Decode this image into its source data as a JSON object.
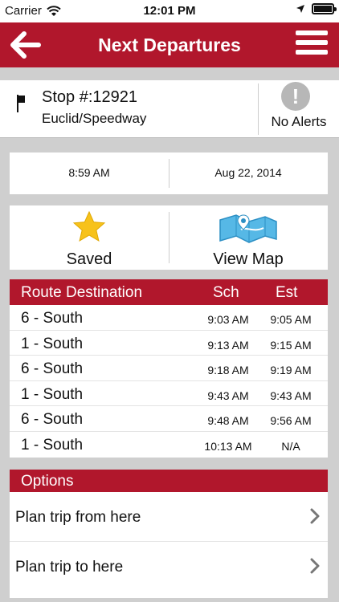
{
  "status_bar": {
    "carrier": "Carrier",
    "time": "12:01 PM"
  },
  "header": {
    "title": "Next Departures"
  },
  "stop": {
    "number": "Stop #:12921",
    "name": "Euclid/Speedway",
    "alerts_label": "No Alerts",
    "alert_symbol": "!"
  },
  "timeinfo": {
    "time": "8:59 AM",
    "date": "Aug 22, 2014"
  },
  "actions": {
    "saved_label": "Saved",
    "map_label": "View Map"
  },
  "departures": {
    "headers": {
      "route": "Route Destination",
      "sch": "Sch",
      "est": "Est"
    },
    "rows": [
      {
        "route": "6 - South",
        "sch": "9:03 AM",
        "est": "9:05 AM"
      },
      {
        "route": "1 - South",
        "sch": "9:13 AM",
        "est": "9:15 AM"
      },
      {
        "route": "6 - South",
        "sch": "9:18 AM",
        "est": "9:19 AM"
      },
      {
        "route": "1 - South",
        "sch": "9:43 AM",
        "est": "9:43 AM"
      },
      {
        "route": "6 - South",
        "sch": "9:48 AM",
        "est": "9:56 AM"
      },
      {
        "route": "1 - South",
        "sch": "10:13 AM",
        "est": "N/A"
      }
    ]
  },
  "options": {
    "title": "Options",
    "items": [
      {
        "label": "Plan trip from here"
      },
      {
        "label": "Plan trip to here"
      }
    ]
  },
  "colors": {
    "brand": "#b1172c",
    "star": "#f7c21b",
    "map": "#3fa9dc"
  },
  "icons": [
    "wifi-icon",
    "location-arrow-icon",
    "battery-icon",
    "back-arrow-icon",
    "hamburger-menu-icon",
    "flag-icon",
    "alert-icon",
    "star-icon",
    "map-icon",
    "chevron-right-icon"
  ]
}
